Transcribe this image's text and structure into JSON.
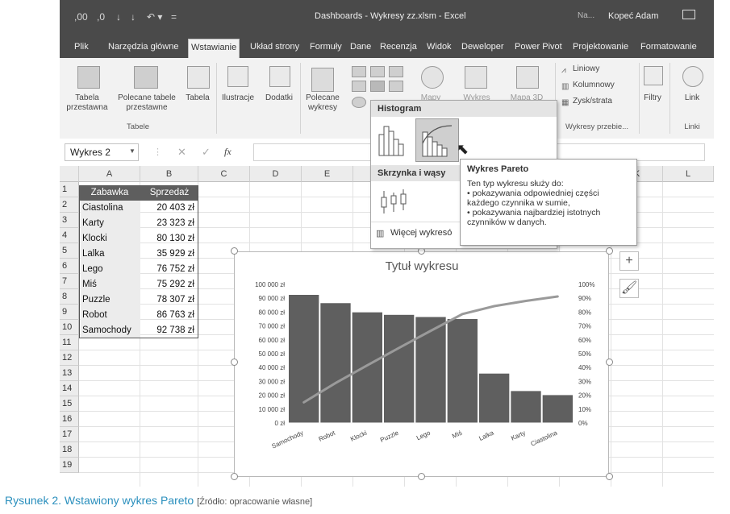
{
  "window": {
    "title": "Dashboards - Wykresy zz.xlsm  -  Excel",
    "user_short": "Na...",
    "user_name": "Kopeć Adam"
  },
  "tabs": [
    "Plik",
    "Narzędzia główne",
    "Wstawianie",
    "Układ strony",
    "Formuły",
    "Dane",
    "Recenzja",
    "Widok",
    "Deweloper",
    "Power Pivot",
    "Projektowanie",
    "Formatowanie"
  ],
  "ribbon": {
    "tabela_przestawna": "Tabela przestawna",
    "polecane_tabele": "Polecane tabele przestawne",
    "tabela": "Tabela",
    "group_tabele": "Tabele",
    "ilustracje": "Ilustracje",
    "dodatki": "Dodatki",
    "polecane_wykresy": "Polecane wykresy",
    "mapy": "Mapy",
    "wykres_przestawny": "Wykres przestawny",
    "mapa_3d": "Mapa 3D",
    "liniowy": "Liniowy",
    "kolumnowy": "Kolumnowy",
    "zysk_strata": "Zysk/strata",
    "group_wykresy_przebiegu": "Wykresy przebie...",
    "filtry": "Filtry",
    "link": "Link",
    "group_linki": "Linki"
  },
  "formula_bar": {
    "name_box": "Wykres 2",
    "fx": "fx"
  },
  "columns": [
    "A",
    "B",
    "C",
    "D",
    "E",
    "F",
    "G",
    "H",
    "I",
    "J",
    "K",
    "L"
  ],
  "rows": [
    "1",
    "2",
    "3",
    "4",
    "5",
    "6",
    "7",
    "8",
    "9",
    "10",
    "11",
    "12",
    "13",
    "14",
    "15",
    "16",
    "17",
    "18",
    "19"
  ],
  "table": {
    "headers": [
      "Zabawka",
      "Sprzedaż"
    ],
    "rows": [
      [
        "Ciastolina",
        "20 403 zł"
      ],
      [
        "Karty",
        "23 323 zł"
      ],
      [
        "Klocki",
        "80 130 zł"
      ],
      [
        "Lalka",
        "35 929 zł"
      ],
      [
        "Lego",
        "76 752 zł"
      ],
      [
        "Miś",
        "75 292 zł"
      ],
      [
        "Puzzle",
        "78 307 zł"
      ],
      [
        "Robot",
        "86 763 zł"
      ],
      [
        "Samochody",
        "92 738 zł"
      ]
    ]
  },
  "dropdown": {
    "section1": "Histogram",
    "section2": "Skrzynka i wąsy",
    "more": "Więcej wykresó"
  },
  "tooltip": {
    "title": "Wykres Pareto",
    "line1": "Ten typ wykresu służy do:",
    "line2": "• pokazywania odpowiedniej części",
    "line3": "każdego czynnika w sumie,",
    "line4": "• pokazywania najbardziej istotnych",
    "line5": "czynników w danych."
  },
  "chart_data": {
    "type": "bar",
    "title": "Tytuł wykresu",
    "categories": [
      "Samochody",
      "Robot",
      "Klocki",
      "Puzzle",
      "Lego",
      "Miś",
      "Lalka",
      "Karty",
      "Ciastolina"
    ],
    "values": [
      92738,
      86763,
      80130,
      78307,
      76752,
      75292,
      35929,
      23323,
      20403
    ],
    "cumulative_percent": [
      14.9,
      28.8,
      41.6,
      54.2,
      66.5,
      78.6,
      84.3,
      88.1,
      91.3
    ],
    "ylim": [
      0,
      100000
    ],
    "y_ticks": [
      "0 zł",
      "10 000 zł",
      "20 000 zł",
      "30 000 zł",
      "40 000 zł",
      "50 000 zł",
      "60 000 zł",
      "70 000 zł",
      "80 000 zł",
      "90 000 zł",
      "100 000 zł"
    ],
    "y2lim": [
      0,
      100
    ],
    "y2_ticks": [
      "0%",
      "10%",
      "20%",
      "30%",
      "40%",
      "50%",
      "60%",
      "70%",
      "80%",
      "90%",
      "100%"
    ],
    "bar_color": "#5f5f5f",
    "line_color": "#9a9a9a"
  },
  "caption": {
    "main": "Rysunek 2. Wstawiony wykres Pareto",
    "source": "[Źródło: opracowanie własne]"
  },
  "colors": {
    "titlebar": "#4a4a4a",
    "header_fill": "#5e5e5e",
    "caption": "#2a8fbd"
  }
}
